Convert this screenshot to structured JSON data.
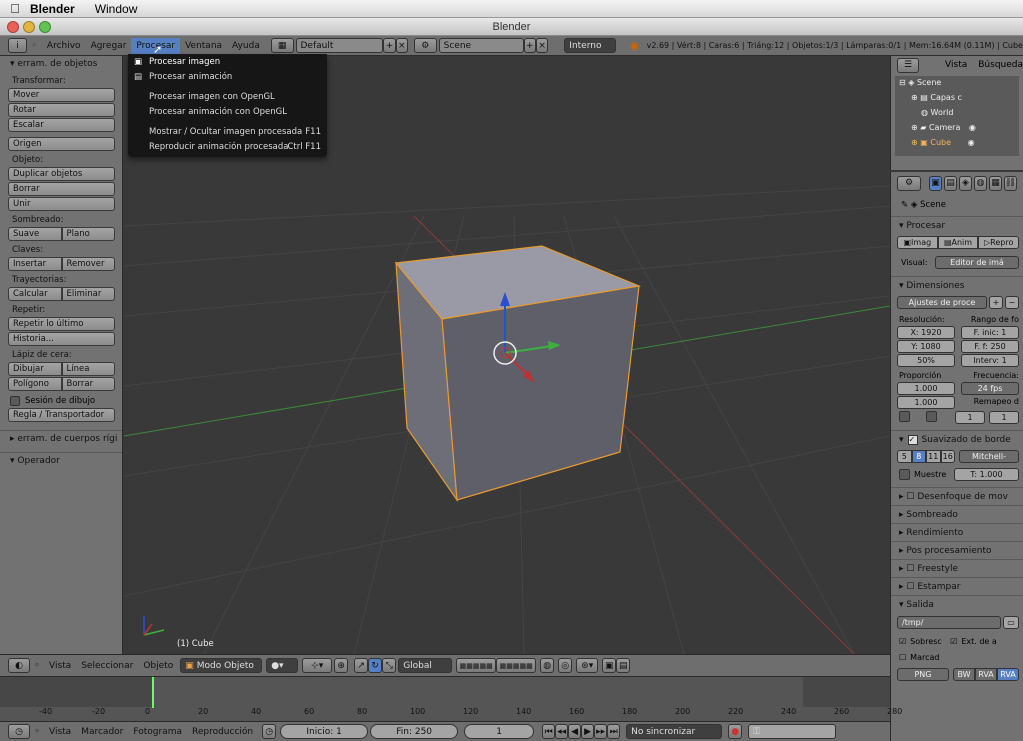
{
  "mac_menubar": {
    "app": "Blender",
    "items": [
      "Window"
    ]
  },
  "window_title": "Blender",
  "info_header": {
    "menus": [
      "Archivo",
      "Agregar",
      "Procesar",
      "Ventana",
      "Ayuda"
    ],
    "active_menu": "Procesar",
    "screen_layout": "Default",
    "scene": "Scene",
    "engine": "Interno",
    "stats": "v2.69 | Vért:8 | Caras:6 | Triáng:12 | Objetos:1/3 | Lámparas:0/1 | Mem:16.64M (0.11M) | Cube"
  },
  "render_menu": {
    "items": [
      {
        "label": "Procesar imagen",
        "shortcut": "",
        "icon": "render-image-icon"
      },
      {
        "label": "Procesar animación",
        "shortcut": "",
        "icon": "render-animation-icon"
      },
      {
        "label": "Procesar imagen con OpenGL",
        "shortcut": ""
      },
      {
        "label": "Procesar animación con OpenGL",
        "shortcut": ""
      },
      {
        "label": "Mostrar / Ocultar imagen procesada",
        "shortcut": "F11"
      },
      {
        "label": "Reproducir animación procesada",
        "shortcut": "Ctrl F11"
      }
    ]
  },
  "tool_shelf": {
    "header": "erram. de objetos",
    "transform_label": "Transformar:",
    "move": "Mover",
    "rotate": "Rotar",
    "scale": "Escalar",
    "origin": "Origen",
    "object_label": "Objeto:",
    "duplicate": "Duplicar objetos",
    "delete": "Borrar",
    "join": "Unir",
    "shading_label": "Sombreado:",
    "smooth": "Suave",
    "flat": "Plano",
    "keys_label": "Claves:",
    "insert": "Insertar",
    "remove": "Remover",
    "paths_label": "Trayectorias:",
    "calculate": "Calcular",
    "clear": "Eliminar",
    "repeat_label": "Repetir:",
    "repeat_last": "Repetir lo último",
    "history": "Historia...",
    "grease_label": "Lápiz de cera:",
    "draw": "Dibujar",
    "line": "Línea",
    "poly": "Polígono",
    "erase": "Borrar",
    "session": "Sesión de dibujo",
    "ruler": "Regla / Transportador",
    "rigid": "erram. de cuerpos rígi",
    "operator": "Operador"
  },
  "viewport": {
    "object_label": "(1) Cube"
  },
  "outliner": {
    "view": "Vista",
    "search": "Búsqueda",
    "items": [
      "Scene",
      "Capas c",
      "World",
      "Camera",
      "Cube"
    ]
  },
  "properties": {
    "scene": "Scene",
    "render_section": "Procesar",
    "render_buttons": [
      "Imag",
      "Anim",
      "Repro"
    ],
    "display_label": "Visual:",
    "display_value": "Editor de imá",
    "dimensions_section": "Dimensiones",
    "preset": "Ajustes de proce",
    "resolution_label": "Resolución:",
    "frame_range_label": "Rango de fo",
    "res_x": "X: 1920",
    "res_y": "Y: 1080",
    "res_pct": "50%",
    "frame_start": "F. inic: 1",
    "frame_end": "F. f: 250",
    "frame_step": "Interv: 1",
    "aspect_label": "Proporción",
    "framerate_label": "Frecuencia:",
    "aspect_x": "1.000",
    "aspect_y": "1.000",
    "fps": "24 fps",
    "remap_label": "Remapeo d",
    "remap_old": "1",
    "remap_new": "1",
    "aa_section": "Suavizado de borde",
    "aa_samples": [
      "5",
      "8",
      "11",
      "16"
    ],
    "aa_filter": "Mitchell-",
    "full_sample": "Muestre",
    "aa_size": "T: 1.000",
    "sections": [
      "Desenfoque de mov",
      "Sombreado",
      "Rendimiento",
      "Pos procesamiento",
      "Freestyle",
      "Estampar",
      "Salida"
    ],
    "output_path": "/tmp/",
    "overwrite": "Sobresc",
    "extension": "Ext. de a",
    "placeholders": "Marcad",
    "format": "PNG",
    "color_modes": [
      "BW",
      "RVA",
      "RVA"
    ]
  },
  "view3d_header": {
    "view": "Vista",
    "select": "Seleccionar",
    "object": "Objeto",
    "mode": "Modo Objeto",
    "orientation": "Global"
  },
  "timeline": {
    "ticks": [
      "-40",
      "-20",
      "0",
      "20",
      "40",
      "60",
      "80",
      "100",
      "120",
      "140",
      "160",
      "180",
      "200",
      "220",
      "240",
      "260",
      "280"
    ],
    "current_frame": 1,
    "header": {
      "view": "Vista",
      "marker": "Marcador",
      "frame": "Fotograma",
      "playback": "Reproducción",
      "start": "Inicio: 1",
      "end": "Fin: 250",
      "current": "1",
      "sync": "No sincronizar"
    }
  },
  "colors": {
    "selection": "#f0a040",
    "x_axis": "#a33",
    "y_axis": "#5a5",
    "menu_highlight": "#5680c2"
  }
}
